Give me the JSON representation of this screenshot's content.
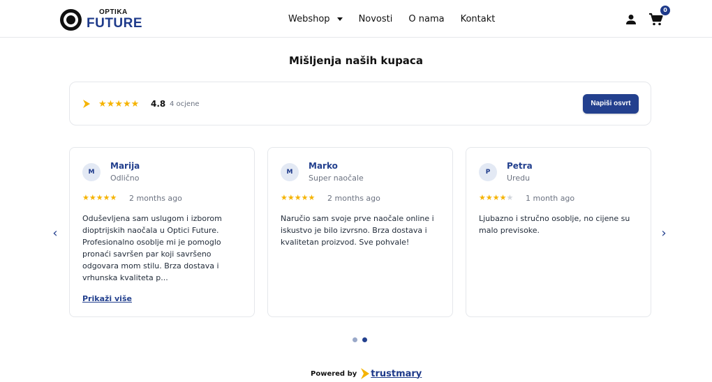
{
  "header": {
    "logo_top": "OPTIKA",
    "logo_bottom": "FUTURE",
    "nav": [
      {
        "label": "Webshop"
      },
      {
        "label": "Novosti"
      },
      {
        "label": "O nama"
      },
      {
        "label": "Kontakt"
      }
    ],
    "cart_count": "0",
    "user_icon": "user-icon",
    "cart_icon": "cart-icon"
  },
  "page_title": "Mišljenja naših kupaca",
  "summary": {
    "stars": "★★★★★",
    "rating": "4.8",
    "count": "4 ocjene",
    "write_button": "Napiši osvrt"
  },
  "reviews": [
    {
      "initial": "M",
      "author": "Marija",
      "title": "Odlično",
      "stars_on": "★★★★★",
      "stars_off": "",
      "date": "2 months ago",
      "text": "Oduševljena sam uslugom i izborom dioptrijskih naočala u Optici Future. Profesionalno osoblje mi je pomoglo pronaći savršen par koji savršeno odgovara mom stilu. Brza dostava i vrhunska kvaliteta p...",
      "more": "Prikaži više"
    },
    {
      "initial": "M",
      "author": "Marko",
      "title": "Super naočale",
      "stars_on": "★★★★★",
      "stars_off": "",
      "date": "2 months ago",
      "text": "Naručio sam svoje prve naočale online i iskustvo je bilo izvrsno. Brza dostava i kvalitetan proizvod. Sve pohvale!"
    },
    {
      "initial": "P",
      "author": "Petra",
      "title": "Uredu",
      "stars_on": "★★★★",
      "stars_off": "★",
      "date": "1 month ago",
      "text": "Ljubazno i stručno osoblje, no cijene su malo previsoke."
    }
  ],
  "carousel": {
    "prev": "‹",
    "next": "›",
    "page": 2,
    "page_count": 2
  },
  "footer": {
    "powered_by": "Powered by",
    "brand": "trustmary"
  },
  "colors": {
    "brand_blue": "#23408e",
    "star": "#f5b301",
    "trustmary_yellow": "#f5b301"
  }
}
